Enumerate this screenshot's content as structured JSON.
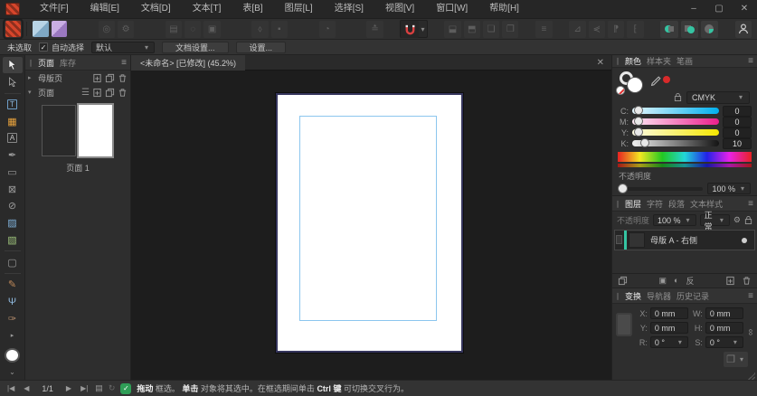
{
  "menu": {
    "items": [
      "文件[F]",
      "编辑[E]",
      "文档[D]",
      "文本[T]",
      "表[B]",
      "图层[L]",
      "选择[S]",
      "视图[V]",
      "窗口[W]",
      "帮助[H]"
    ]
  },
  "window_controls": {
    "minimize": "–",
    "maximize": "▢",
    "close": "✕"
  },
  "context_toolbar": {
    "selection_status": "未选取",
    "auto_select_label": "自动选择",
    "preset_value": "默认",
    "document_setup_label": "文档设置...",
    "settings_label": "设置..."
  },
  "document_tab": {
    "title": "<未命名> [已修改] (45.2%)",
    "close": "✕"
  },
  "pages_panel": {
    "tab_pages": "页面",
    "tab_stock": "库存",
    "master_pages_label": "母版页",
    "pages_label": "页面",
    "page_thumb_label": "页面 1"
  },
  "color_panel": {
    "tab_color": "颜色",
    "tab_swatches": "样本夹",
    "tab_stroke": "笔画",
    "mode": "CMYK",
    "sliders": [
      {
        "label": "C:",
        "value": "0"
      },
      {
        "label": "M:",
        "value": "0"
      },
      {
        "label": "Y:",
        "value": "0"
      },
      {
        "label": "K:",
        "value": "10"
      }
    ],
    "opacity_label": "不透明度",
    "opacity_value": "100 %"
  },
  "layers_panel": {
    "tab_layers": "图层",
    "tab_character": "字符",
    "tab_paragraph": "段落",
    "tab_text_styles": "文本样式",
    "opacity_label": "不透明度",
    "opacity_value": "100 %",
    "blend_mode": "正常",
    "layer_name": "母版 A - 右侧",
    "invert_glyph": "反"
  },
  "transform_panel": {
    "tab_transform": "变换",
    "tab_navigator": "导航器",
    "tab_history": "历史记录",
    "x_label": "X:",
    "x_value": "0 mm",
    "y_label": "Y:",
    "y_value": "0 mm",
    "w_label": "W:",
    "w_value": "0 mm",
    "h_label": "H:",
    "h_value": "0 mm",
    "r_label": "R:",
    "r_value": "0 °",
    "s_label": "S:",
    "s_value": "0 °"
  },
  "status_bar": {
    "page_indicator": "1/1",
    "hint_bold1": "拖动",
    "hint_text1": " 框选。",
    "hint_bold2": "单击",
    "hint_text2": " 对象将其选中。在框选期间单击 ",
    "hint_bold3": "Ctrl 键",
    "hint_text3": " 可切换交叉行为。"
  },
  "colors": {
    "accent_teal": "#35c4a2",
    "margin_blue": "#8cc6ee",
    "magnet_red": "#d84040",
    "preflight_green": "#2f9e57"
  }
}
